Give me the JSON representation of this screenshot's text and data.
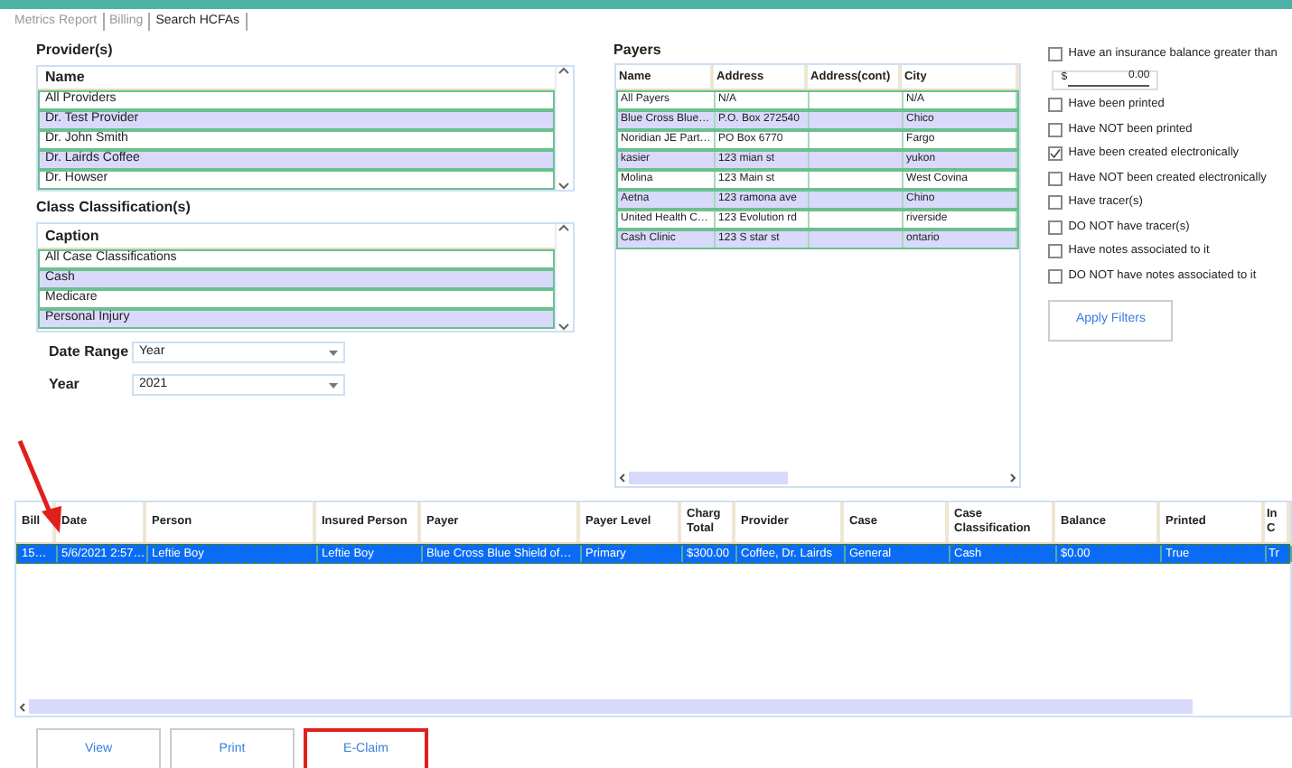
{
  "tabs": [
    {
      "label": "Metrics Report",
      "selected": false
    },
    {
      "label": "Billing",
      "selected": false
    },
    {
      "label": "Search HCFAs",
      "selected": true
    }
  ],
  "providers": {
    "title": "Provider(s)",
    "column": "Name",
    "rows": [
      "All Providers",
      "Dr. Test Provider",
      "Dr. John Smith",
      "Dr. Lairds Coffee",
      "Dr. Howser"
    ]
  },
  "classifications": {
    "title": "Class Classification(s)",
    "column": "Caption",
    "rows": [
      "All Case Classifications",
      "Cash",
      "Medicare",
      "Personal Injury"
    ]
  },
  "date_range": {
    "label": "Date Range",
    "value": "Year"
  },
  "year": {
    "label": "Year",
    "value": "2021"
  },
  "payers": {
    "title": "Payers",
    "columns": [
      "Name",
      "Address",
      "Address(cont)",
      "City"
    ],
    "rows": [
      [
        "All Payers",
        "N/A",
        "",
        "N/A"
      ],
      [
        "Blue Cross Blue…",
        "P.O. Box 272540",
        "",
        "Chico"
      ],
      [
        "Noridian JE Part…",
        "PO Box 6770",
        "",
        "Fargo"
      ],
      [
        "kasier",
        "123 mian st",
        "",
        "yukon"
      ],
      [
        "Molina",
        "123 Main st",
        "",
        "West Covina"
      ],
      [
        "Aetna",
        "123 ramona ave",
        "",
        "Chino"
      ],
      [
        "United Health C…",
        "123 Evolution rd",
        "",
        "riverside"
      ],
      [
        "Cash Clinic",
        "123 S star st",
        "",
        "ontario"
      ]
    ]
  },
  "filters": [
    {
      "label": "Have an insurance balance greater than",
      "checked": false
    },
    {
      "label": "Have been printed",
      "checked": false
    },
    {
      "label": "Have NOT been printed",
      "checked": false
    },
    {
      "label": "Have been created electronically",
      "checked": true
    },
    {
      "label": "Have NOT been created electronically",
      "checked": false
    },
    {
      "label": "Have tracer(s)",
      "checked": false
    },
    {
      "label": "DO NOT have tracer(s)",
      "checked": false
    },
    {
      "label": "Have notes associated to it",
      "checked": false
    },
    {
      "label": "DO NOT have notes associated to it",
      "checked": false
    }
  ],
  "balance_field": {
    "currency": "$",
    "value": "0.00"
  },
  "apply_button": "Apply Filters",
  "results": {
    "columns": [
      "Bill",
      "Date",
      "Person",
      "Insured Person",
      "Payer",
      "Payer Level",
      "Charg Total",
      "Provider",
      "Case",
      "Case Classification",
      "Balance",
      "Printed",
      "In C"
    ],
    "rows": [
      {
        "selected": true,
        "cells": [
          "15…",
          "5/6/2021  2:57…",
          "Leftie Boy",
          "Leftie Boy",
          "Blue Cross Blue Shield of…",
          "Primary",
          "$300.00",
          "Coffee, Dr. Lairds",
          "General",
          "Cash",
          "$0.00",
          "True",
          "Tr"
        ]
      }
    ]
  },
  "buttons": [
    {
      "label": "View",
      "highlighted": false
    },
    {
      "label": "Print",
      "highlighted": false
    },
    {
      "label": "E-Claim",
      "highlighted": true
    }
  ]
}
